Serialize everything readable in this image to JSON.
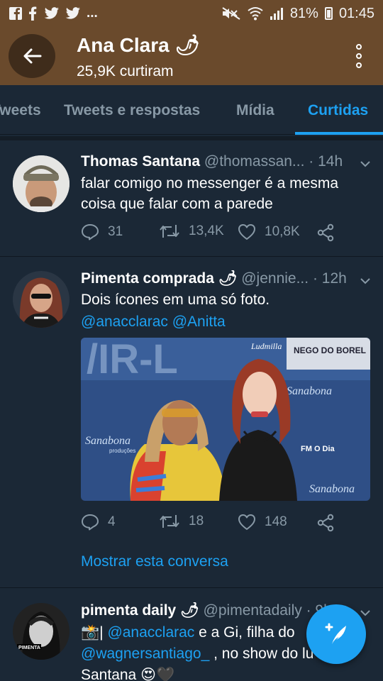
{
  "status_bar": {
    "notification_icons": [
      "facebook-icon",
      "facebook-icon",
      "twitter-icon",
      "twitter-icon"
    ],
    "more": "...",
    "battery": "81%",
    "time": "01:45"
  },
  "header": {
    "title": "Ana Clara 🌶",
    "subtitle": "25,9K curtiram"
  },
  "tabs": [
    {
      "label": "Tweets"
    },
    {
      "label": "Tweets e respostas"
    },
    {
      "label": "Mídia"
    },
    {
      "label": "Curtidas"
    }
  ],
  "tweets": [
    {
      "name": "Thomas Santana",
      "handle": "@thomassan...",
      "time": "· 14h",
      "text": "falar comigo no messenger é a mesma coisa que falar com a parede",
      "replies": "31",
      "retweets": "13,4K",
      "likes": "10,8K"
    },
    {
      "name": "Pimenta comprada 🌶",
      "handle": "@jennie...",
      "time": "· 12h",
      "text": "Dois ícones em uma só foto.",
      "mentions": "@anacclarac @Anitta",
      "replies": "4",
      "retweets": "18",
      "likes": "148",
      "show_conversation": "Mostrar esta conversa",
      "photo_texts": [
        "Sanabona",
        "produções",
        "NEGO DO BOREL",
        "FM O Dia",
        "Ludmilla"
      ]
    },
    {
      "name": "pimenta daily 🌶",
      "handle": "@pimentadaily · 9h",
      "text_prefix": "📸| ",
      "mention1": "@anacclarac",
      "text_mid": " e a Gi, filha do",
      "mention2": "@wagnersantiago_",
      "text_end": " , no show do lu",
      "line3": "Santana 😍🖤",
      "avatar_label": "PIMENTA"
    }
  ],
  "colors": {
    "accent": "#1da1f2",
    "header_bg": "#6a4a2c",
    "feed_bg": "#1b2836",
    "secondary_text": "#8899a6"
  }
}
